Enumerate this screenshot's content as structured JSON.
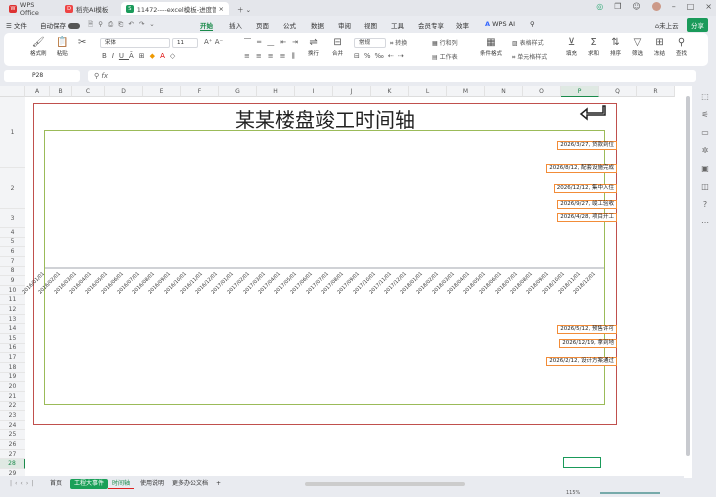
{
  "tabs": [
    {
      "label": "WPS Office",
      "icon": "wps-logo"
    },
    {
      "label": "稻壳AI模板",
      "icon": "docer-icon"
    },
    {
      "label": "11472----excel模板-进度管理",
      "icon": "sheet-icon",
      "active": true
    }
  ],
  "menu": {
    "file": "文件",
    "autosave": "自动保存",
    "items": [
      "开始",
      "插入",
      "页面",
      "公式",
      "数据",
      "审阅",
      "视图",
      "工具",
      "会员专享",
      "效率"
    ],
    "active": "开始",
    "wpsai": "WPS AI",
    "cloud": "未上云",
    "share": "分享"
  },
  "ribbon": {
    "format_painter": "格式刷",
    "paste": "粘贴",
    "font": "宋体",
    "size": "11",
    "wrap": "换行",
    "merge": "合并",
    "numfmt": "常规",
    "convert": "转换",
    "rowcol": "行和列",
    "worksheet": "工作表",
    "condfmt": "条件格式",
    "tablestyle": "表格样式",
    "cellstyle": "单元格样式",
    "fill": "填充",
    "sum": "求和",
    "sort": "排序",
    "filter": "筛选",
    "freeze": "冻结",
    "find": "查找"
  },
  "formula": {
    "cell": "P28",
    "fx": "fx",
    "value": ""
  },
  "columns": [
    "A",
    "B",
    "C",
    "D",
    "E",
    "F",
    "G",
    "H",
    "I",
    "J",
    "K",
    "L",
    "M",
    "N",
    "O",
    "P",
    "Q",
    "R"
  ],
  "selected_col": "P",
  "selected_row": 28,
  "rows": [
    1,
    2,
    3,
    4,
    5,
    6,
    7,
    8,
    9,
    10,
    11,
    12,
    13,
    14,
    15,
    16,
    17,
    18,
    19,
    20,
    21,
    22,
    23,
    24,
    25,
    26,
    27,
    28,
    29
  ],
  "chart": {
    "title": "某某楼盘竣工时间轴",
    "axis_labels": [
      "2016/01/01",
      "2016/02/01",
      "2016/03/01",
      "2016/04/01",
      "2016/05/01",
      "2016/06/01",
      "2016/07/01",
      "2016/08/01",
      "2016/09/01",
      "2016/10/01",
      "2016/11/01",
      "2016/12/01",
      "2017/01/01",
      "2017/02/01",
      "2017/03/01",
      "2017/04/01",
      "2017/05/01",
      "2017/06/01",
      "2017/07/01",
      "2017/08/01",
      "2017/09/01",
      "2017/10/01",
      "2017/11/01",
      "2017/12/01",
      "2018/01/01",
      "2018/02/01",
      "2018/03/01",
      "2018/04/01",
      "2018/05/01",
      "2018/06/01",
      "2018/07/01",
      "2018/08/01",
      "2018/09/01",
      "2018/10/01",
      "2018/11/01",
      "2018/12/01"
    ],
    "events_above": [
      "2026/3/27, 贷款到位",
      "2026/8/12, 配套设施完成",
      "2026/12/12, 集中入住",
      "2026/9/27, 竣工验收",
      "2026/4/28, 项目开工"
    ],
    "events_below": [
      "2026/5/12, 预售许可",
      "2026/12/19, 拿到地",
      "2026/2/12, 设计方案通过"
    ],
    "colors": {
      "outer": "#c0504d",
      "inner": "#9bbb59",
      "label_border": "#f28c38"
    }
  },
  "sheets": [
    "首页",
    "工程大事件",
    "时间轴",
    "使用说明",
    "更多办公文档"
  ],
  "active_sheet": "时间轴",
  "status": {
    "zoom": "115%"
  }
}
